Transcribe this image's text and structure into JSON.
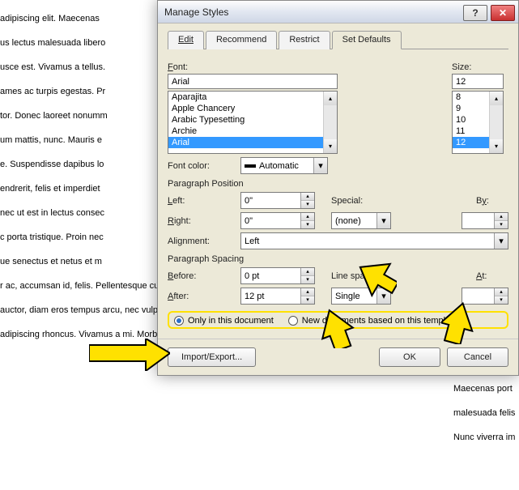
{
  "bg": {
    "lines": [
      "adipiscing elit. Maecenas",
      "us lectus malesuada libero",
      "usce est. Vivamus a tellus.",
      "ames ac turpis egestas. Pr",
      "tor. Donec laoreet nonumm",
      "um mattis, nunc. Mauris e",
      "",
      "e. Suspendisse dapibus lo",
      "endrerit, felis et imperdiet",
      "nec ut est in lectus consec",
      "c porta tristique. Proin nec",
      "ue senectus et netus et m",
      "",
      "",
      "r ac, accumsan id, felis. Pellentesque cursus sagittis felis.",
      "auctor, diam eros tempus arcu, nec vulputate augue",
      "adipiscing rhoncus. Vivamus a mi. Morbi neque. Aliquam"
    ],
    "col2": [
      "Maecenas port",
      "malesuada felis",
      "Nunc viverra im"
    ]
  },
  "dialog": {
    "title": "Manage Styles",
    "tabs": {
      "edit": "Edit",
      "recommend": "Recommend",
      "restrict": "Restrict",
      "setdefaults": "Set Defaults"
    },
    "font_label": "Font:",
    "size_label": "Size:",
    "font_value": "Arial",
    "size_value": "12",
    "font_list": [
      "Aparajita",
      "Apple Chancery",
      "Arabic Typesetting",
      "Archie",
      "Arial"
    ],
    "size_list": [
      "8",
      "9",
      "10",
      "11",
      "12"
    ],
    "font_color_label": "Font color:",
    "font_color_value": "Automatic",
    "para_pos": "Paragraph Position",
    "left": "Left:",
    "left_v": "0\"",
    "right": "Right:",
    "right_v": "0\"",
    "special": "Special:",
    "special_v": "(none)",
    "by": "By:",
    "alignment": "Alignment:",
    "alignment_v": "Left",
    "para_spacing": "Paragraph Spacing",
    "before": "Before:",
    "before_v": "0 pt",
    "after": "After:",
    "after_v": "12 pt",
    "linespacing": "Line spacing:",
    "linespacing_v": "Single",
    "at": "At:",
    "radio1": "Only in this document",
    "radio2": "New documents based on this template",
    "import": "Import/Export...",
    "ok": "OK",
    "cancel": "Cancel"
  }
}
